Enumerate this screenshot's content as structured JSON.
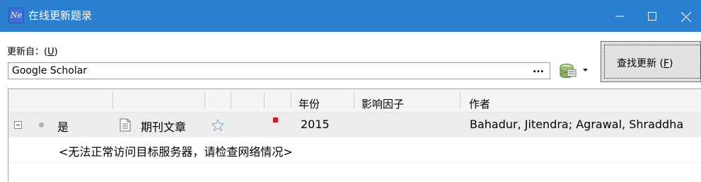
{
  "window": {
    "title": "在线更新题录",
    "app_icon_text": "Ne",
    "accent_color": "#2b7fd0"
  },
  "update_from": {
    "label": "更新自：",
    "mnemonic": "U",
    "source_value": "Google Scholar",
    "browse_label": "..."
  },
  "find_button": {
    "label": "查找更新",
    "mnemonic": "F"
  },
  "table": {
    "columns": [
      "",
      "",
      "",
      "",
      "",
      "年份",
      "影响因子",
      "作者"
    ],
    "rows": [
      {
        "status": "是",
        "type": "期刊文章",
        "year": "2015",
        "impact_factor": "",
        "authors": "Bahadur, Jitendra; Agrawal, Shraddha"
      }
    ],
    "message": "<无法正常访问目标服务器，请检查网络情况>"
  },
  "icons": {
    "collapse": "minus-box-icon",
    "dot": "bullet-icon",
    "document": "document-icon",
    "star": "star-icon",
    "flag": "red-flag-icon",
    "database": "database-icon",
    "dropdown": "chevron-down-icon"
  }
}
